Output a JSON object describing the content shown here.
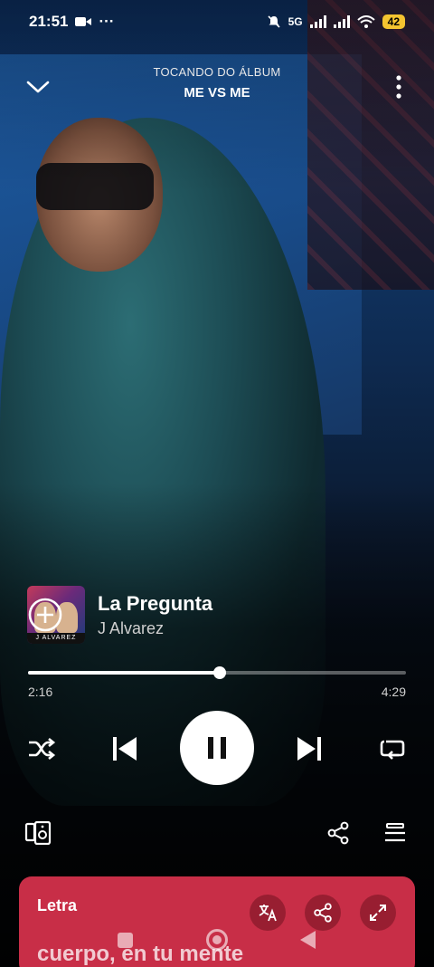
{
  "status_bar": {
    "time": "21:51",
    "network": "5G",
    "battery": "42"
  },
  "header": {
    "context_label": "TOCANDO DO ÁLBUM",
    "album_name": "ME VS ME"
  },
  "track": {
    "title": "La Pregunta",
    "artist": "J Alvarez",
    "cover_caption": "J ALVAREZ"
  },
  "playback": {
    "elapsed": "2:16",
    "duration": "4:29",
    "progress_fraction": 0.506
  },
  "lyrics": {
    "label": "Letra",
    "current_line": "cuerpo, en tu mente"
  },
  "colors": {
    "lyrics_card": "#c82e47",
    "battery_badge": "#f4c430"
  },
  "icons": [
    "chevron-down-icon",
    "more-vert-icon",
    "add-circle-icon",
    "shuffle-icon",
    "skip-previous-icon",
    "pause-icon",
    "skip-next-icon",
    "repeat-icon",
    "connect-device-icon",
    "share-icon",
    "queue-icon",
    "translate-icon",
    "expand-icon"
  ]
}
